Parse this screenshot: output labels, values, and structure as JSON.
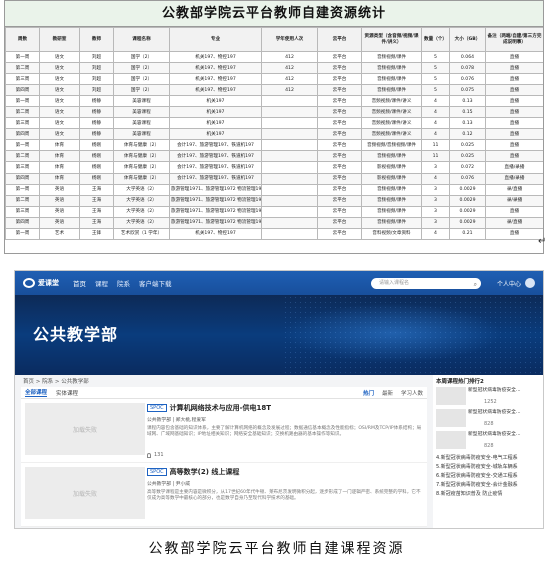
{
  "table": {
    "title": "公教部学院云平台教师自建资源统计",
    "headers": [
      "周数",
      "教研室",
      "教师",
      "课程名称",
      "专业",
      "学年使用人次",
      "云平台",
      "资源类型（含音频/视频/课件/讲义）",
      "数量（个）",
      "大小（GB）",
      "备注（两端/自建/第三方完成说明事）"
    ],
    "rows": [
      [
        "第一周",
        "语文",
        "刘超",
        "国学（2）",
        "机关197、物控197",
        "412",
        "云平台",
        "音频视频/课件",
        "5",
        "0.064",
        "直播"
      ],
      [
        "第二周",
        "语文",
        "刘超",
        "国学（2）",
        "机关197、物控197",
        "412",
        "云平台",
        "音频视频/课件",
        "5",
        "0.078",
        "直播"
      ],
      [
        "第三周",
        "语文",
        "刘超",
        "国学（2）",
        "机关197、物控197",
        "412",
        "云平台",
        "音频视频/课件",
        "5",
        "0.076",
        "直播"
      ],
      [
        "第四周",
        "语文",
        "刘超",
        "国学（2）",
        "机关197、物控197",
        "412",
        "云平台",
        "音频视频/课件",
        "5",
        "0.075",
        "直播"
      ],
      [
        "第一周",
        "语文",
        "杨静",
        "美容课程",
        "机关197",
        "",
        "云平台",
        "音频视频/课件/讲义",
        "4",
        "0.13",
        "直播"
      ],
      [
        "第二周",
        "语文",
        "杨静",
        "美容课程",
        "机关197",
        "",
        "云平台",
        "音频视频/课件/讲义",
        "4",
        "0.15",
        "直播"
      ],
      [
        "第三周",
        "语文",
        "杨静",
        "美容课程",
        "机关197",
        "",
        "云平台",
        "音频视频/课件/讲义",
        "4",
        "0.13",
        "直播"
      ],
      [
        "第四周",
        "语文",
        "杨静",
        "美容课程",
        "机关197",
        "",
        "云平台",
        "音频视频/课件/讲义",
        "4",
        "0.12",
        "直播"
      ],
      [
        "第一周",
        "体育",
        "杨刚",
        "体育与健康（2）",
        "会计197、旅游管理197、铁道机197",
        "",
        "云平台",
        "音频视频/音频视频/课件",
        "11",
        "0.025",
        "直播"
      ],
      [
        "第二周",
        "体育",
        "杨刚",
        "体育与健康（2）",
        "会计197、旅游管理197、铁道机197",
        "",
        "云平台",
        "音频视频/课件",
        "11",
        "0.025",
        "直播"
      ],
      [
        "第三周",
        "体育",
        "杨刚",
        "体育与健康（2）",
        "会计197、旅游管理197、铁道机197",
        "",
        "云平台",
        "影视视频/课件",
        "3",
        "0.072",
        "直播/录播"
      ],
      [
        "第四周",
        "体育",
        "杨刚",
        "体育与健康（2）",
        "会计197、旅游管理197、铁道机197",
        "",
        "云平台",
        "影视视频/课件",
        "4",
        "0.076",
        "直播/录播"
      ],
      [
        "第一周",
        "英语",
        "王海",
        "大学英语（2）",
        "旅游管理1971、旅游管理1972 物流管理1971",
        "",
        "云平台",
        "音频视频/课件",
        "3",
        "0.0029",
        "录/直播"
      ],
      [
        "第二周",
        "英语",
        "王海",
        "大学英语（2）",
        "旅游管理1971、旅游管理1972 物流管理1971",
        "",
        "云平台",
        "音频视频/课件",
        "3",
        "0.0029",
        "录/录播"
      ],
      [
        "第三周",
        "英语",
        "王海",
        "大学英语（2）",
        "旅游管理1971、旅游管理1972 物流管理1971",
        "",
        "云平台",
        "音频视频/课件",
        "3",
        "0.0029",
        "直播"
      ],
      [
        "第四周",
        "英语",
        "王海",
        "大学英语（2）",
        "旅游管理1971、旅游管理1972 物流管理1971",
        "",
        "云平台",
        "音频视频/课件",
        "3",
        "0.0029",
        "录/直播"
      ],
      [
        "第一周",
        "艺术",
        "王锋",
        "艺术欣赏（1 学年）",
        "机关197、物控197",
        "",
        "云平台",
        "音料视频/文章资料",
        "4",
        "0.21",
        "直播"
      ]
    ]
  },
  "screenshot": {
    "logo": "爱课堂",
    "nav": [
      "首页",
      "课程",
      "院系",
      "客户端下载"
    ],
    "search_placeholder": "请输入课程名",
    "user_center": "个人中心",
    "banner_title": "公共教学部",
    "breadcrumb": "首页 > 院系 > 公共教学部",
    "tabs": [
      "全部课程",
      "实体课程"
    ],
    "sort_tabs": [
      "热门",
      "最新",
      "学习人数"
    ],
    "courses": [
      {
        "badge": "SPOC",
        "thumb_text": "加载失败",
        "title": "计算机网络技术与应用-供电18T",
        "meta": "公共教学部  |  郑大桃,程爱军",
        "desc": "课程内容包含基础的知识体系，主要了解计算机网络的概念及发展过程；数据通信基本概念及性能指标；OSI/RM及TCP/IP体系结构；局域网、广域网基础知识；IP地址相关知识；网络安全基础知识；交换机路由器的基本操作等知识。",
        "count": "131"
      },
      {
        "badge": "SPOC",
        "thumb_text": "加载失败",
        "title": "高等数学(2) 线上课程",
        "meta": "公共教学部  |  尹小威",
        "desc": "高等数学课程是主要内容是微积分，从17世纪60年代牛顿、莱布尼茨发明微积分起，逐步形成了一门逻辑严密、系统完整的学科，它不仅成为高等数学中最核心的部分，也是数学自身乃至现代科学技术的基础。",
        "count": ""
      }
    ],
    "side": {
      "title": "本周课程热门排行2",
      "cards": [
        {
          "name": "新型冠状病毒防疫安全...",
          "count": "1252"
        },
        {
          "name": "新型冠状病毒防疫安全...",
          "count": "828"
        },
        {
          "name": "新型冠状病毒防疫安全...",
          "count": "828"
        }
      ],
      "list": [
        "4.新型冠状病毒防疫安全-电气工程系",
        "5.新型冠状病毒防疫安全-城轨车辆系",
        "6.新型冠状病毒防疫安全-交通工程系",
        "7.新型冠状病毒防疫安全-会计金融系",
        "8.新冠疫苗知识普及 防止疫情"
      ]
    }
  },
  "caption": "公教部学院云平台教师自建课程资源"
}
